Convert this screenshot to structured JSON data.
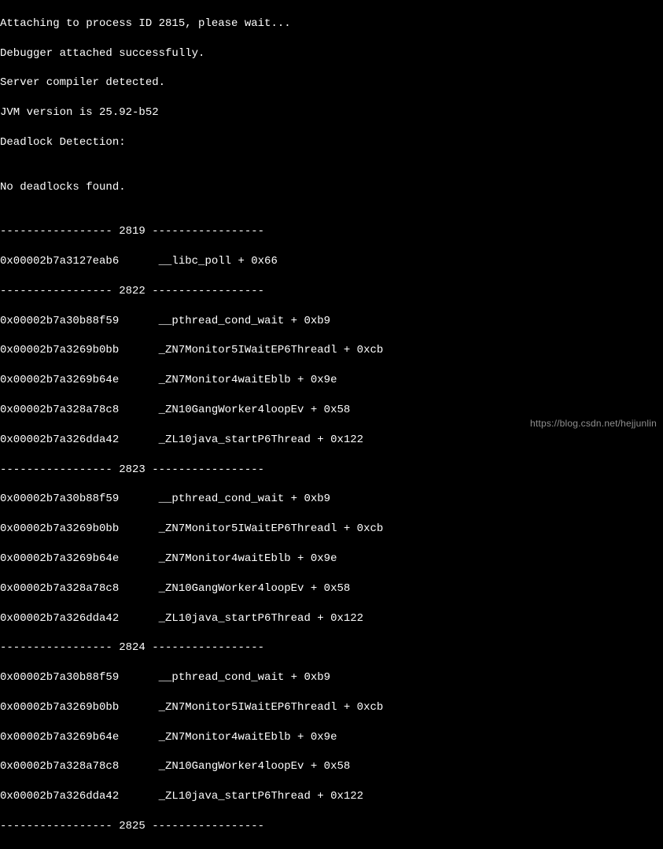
{
  "header": {
    "attaching": "Attaching to process ID 2815, please wait...",
    "attached": "Debugger attached successfully.",
    "compiler": "Server compiler detected.",
    "jvm": "JVM version is 25.92-b52",
    "deadlock_title": "Deadlock Detection:",
    "blank": "",
    "no_deadlocks": "No deadlocks found.",
    "blank2": ""
  },
  "separators": {
    "s2819": "----------------- 2819 -----------------",
    "s2822": "----------------- 2822 -----------------",
    "s2823": "----------------- 2823 -----------------",
    "s2824": "----------------- 2824 -----------------",
    "s2825": "----------------- 2825 -----------------"
  },
  "frames": {
    "libc_poll": "0x00002b7a3127eab6      __libc_poll + 0x66",
    "pthread": "0x00002b7a30b88f59      __pthread_cond_wait + 0xb9",
    "mon_iwait": "0x00002b7a3269b0bb      _ZN7Monitor5IWaitEP6Threadl + 0xcb",
    "mon_wait": "0x00002b7a3269b64e      _ZN7Monitor4waitEblb + 0x9e",
    "gang": "0x00002b7a328a78c8      _ZN10GangWorker4loopEv + 0x58",
    "java_start": "0x00002b7a326dda42      _ZL10java_startP6Thread + 0x122"
  },
  "watermark": "https://blog.csdn.net/hejjunlin"
}
